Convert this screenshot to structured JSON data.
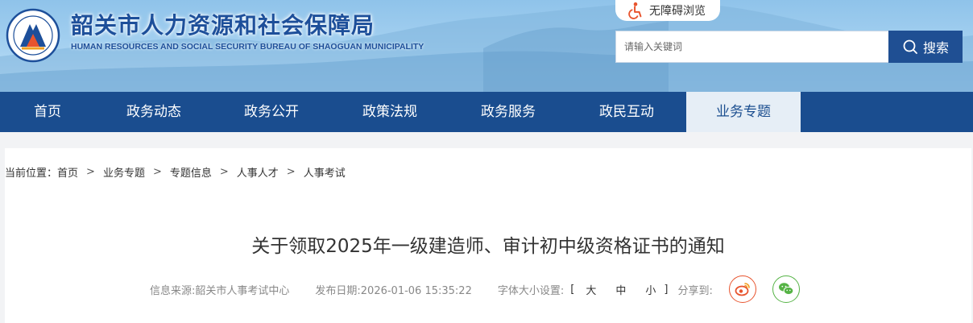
{
  "header": {
    "title": "韶关市人力资源和社会保障局",
    "subtitle": "HUMAN RESOURCES AND SOCIAL SECURITY BUREAU OF SHAOGUAN MUNICIPALITY",
    "logo_icon": "bureau-emblem-icon",
    "accessibility_label": "无障碍浏览",
    "accessibility_icon": "wheelchair-icon",
    "search": {
      "placeholder": "请输入关键词",
      "button_label": "搜索",
      "button_icon": "search-icon"
    },
    "colors": {
      "title": "#1d4f9a",
      "search_button": "#1f4f93",
      "accessibility_icon": "#e8542e"
    }
  },
  "nav": {
    "items": [
      {
        "label": "首页",
        "active": false
      },
      {
        "label": "政务动态",
        "active": false
      },
      {
        "label": "政务公开",
        "active": false
      },
      {
        "label": "政策法规",
        "active": false
      },
      {
        "label": "政务服务",
        "active": false
      },
      {
        "label": "政民互动",
        "active": false
      },
      {
        "label": "业务专题",
        "active": true
      }
    ],
    "colors": {
      "background": "#1a4d8f",
      "active_background": "#e6eef6"
    }
  },
  "breadcrumb": {
    "prefix": "当前位置：",
    "separator": ">",
    "items": [
      "首页",
      "业务专题",
      "专题信息",
      "人事人才",
      "人事考试"
    ]
  },
  "article": {
    "title": "关于领取2025年一级建造师、审计初中级资格证书的通知",
    "source": "信息来源:韶关市人事考试中心",
    "published": "发布日期:2026-01-06 15:35:22",
    "font_size_label": "字体大小设置:",
    "bracket_open": "[",
    "bracket_close": "]",
    "font_sizes": [
      "大",
      "中",
      "小"
    ],
    "share_label": "分享到:",
    "share_icons": [
      "weibo-icon",
      "wechat-icon"
    ],
    "colors": {
      "weibo": "#e8542e",
      "wechat": "#55b345"
    }
  }
}
